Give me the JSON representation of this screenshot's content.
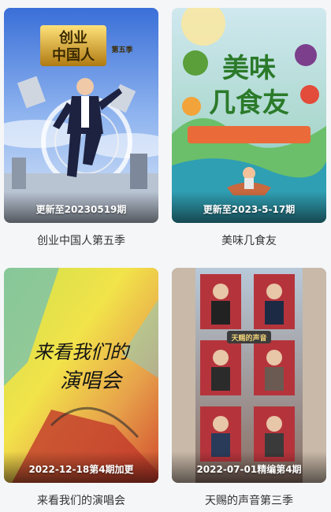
{
  "cards": [
    {
      "title": "创业中国人第五季",
      "update": "更新至20230519期",
      "poster_text": [
        "创业",
        "中国人",
        "第五季"
      ]
    },
    {
      "title": "美味几食友",
      "update": "更新至2023-5-17期",
      "poster_text": [
        "美味",
        "几食友"
      ]
    },
    {
      "title": "来看我们的演唱会",
      "update": "2022-12-18第4期加更",
      "poster_text": [
        "来看我们的",
        "演唱会"
      ]
    },
    {
      "title": "天赐的声音第三季",
      "update": "2022-07-01精编第4期",
      "poster_text": [
        "天赐的声音"
      ]
    }
  ],
  "colors": {
    "page_bg": "#f5f6f8",
    "title_text": "#333333",
    "overlay_text": "#ffffff"
  }
}
